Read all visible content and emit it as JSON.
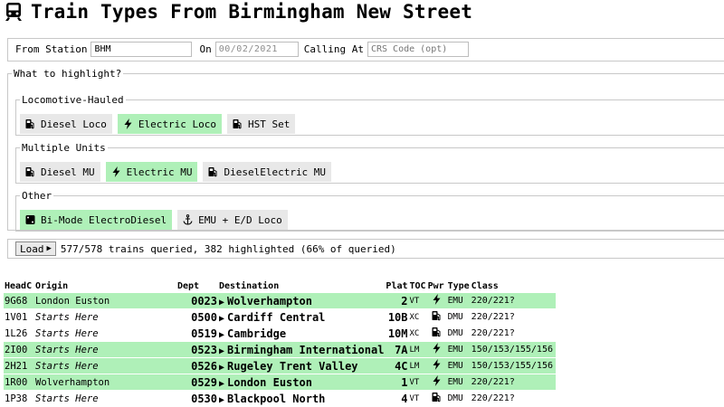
{
  "page": {
    "title": "Train Types From Birmingham New Street",
    "title_icon": "train-icon"
  },
  "query": {
    "from_label": "From Station",
    "from_value": "BHM",
    "on_label": "On",
    "on_value": "00/02/2021",
    "calling_label": "Calling At",
    "calling_placeholder": "CRS Code (opt)"
  },
  "highlight": {
    "legend": "What to highlight?",
    "groups": [
      {
        "legend": "Locomotive-Hauled",
        "buttons": [
          {
            "label": "Diesel Loco",
            "icon": "fuel-pump-icon",
            "on": false
          },
          {
            "label": "Electric Loco",
            "icon": "lightning-bolt-icon",
            "on": true
          },
          {
            "label": "HST Set",
            "icon": "fuel-pump-icon",
            "on": false
          }
        ]
      },
      {
        "legend": "Multiple Units",
        "buttons": [
          {
            "label": "Diesel MU",
            "icon": "fuel-pump-icon",
            "on": false
          },
          {
            "label": "Electric MU",
            "icon": "lightning-bolt-icon",
            "on": true
          },
          {
            "label": "DieselElectric MU",
            "icon": "fuel-pump-icon",
            "on": false
          }
        ]
      },
      {
        "legend": "Other",
        "buttons": [
          {
            "label": "Bi-Mode ElectroDiesel",
            "icon": "dice-icon",
            "on": true
          },
          {
            "label": "EMU + E/D Loco",
            "icon": "anchor-icon",
            "on": false
          }
        ]
      }
    ]
  },
  "load": {
    "button_label": "Load",
    "status": "577/578 trains queried, 382 highlighted (66% of queried)"
  },
  "table": {
    "headers": {
      "headcode": "HeadC",
      "origin": "Origin",
      "dept": "Dept",
      "destination": "Destination",
      "plat": "Plat",
      "toc": "TOC",
      "pwr": "Pwr",
      "type": "Type",
      "class": "Class"
    },
    "rows": [
      {
        "headcode": "9G68",
        "origin": "London Euston",
        "origin_italic": false,
        "dept": "0023",
        "destination": "Wolverhampton",
        "plat": "2",
        "toc": "VT",
        "pwr": "lightning-bolt-icon",
        "type": "EMU",
        "class": "220/221?",
        "highlight": true
      },
      {
        "headcode": "1V01",
        "origin": "Starts Here",
        "origin_italic": true,
        "dept": "0500",
        "destination": "Cardiff Central",
        "plat": "10B",
        "toc": "XC",
        "pwr": "fuel-pump-icon",
        "type": "DMU",
        "class": "220/221?",
        "highlight": false
      },
      {
        "headcode": "1L26",
        "origin": "Starts Here",
        "origin_italic": true,
        "dept": "0519",
        "destination": "Cambridge",
        "plat": "10M",
        "toc": "XC",
        "pwr": "fuel-pump-icon",
        "type": "DMU",
        "class": "220/221?",
        "highlight": false
      },
      {
        "headcode": "2I00",
        "origin": "Starts Here",
        "origin_italic": true,
        "dept": "0523",
        "destination": "Birmingham International",
        "plat": "7A",
        "toc": "LM",
        "pwr": "lightning-bolt-icon",
        "type": "EMU",
        "class": "150/153/155/156",
        "highlight": true
      },
      {
        "headcode": "2H21",
        "origin": "Starts Here",
        "origin_italic": true,
        "dept": "0526",
        "destination": "Rugeley Trent Valley",
        "plat": "4C",
        "toc": "LM",
        "pwr": "lightning-bolt-icon",
        "type": "EMU",
        "class": "150/153/155/156",
        "highlight": true
      },
      {
        "headcode": "1R00",
        "origin": "Wolverhampton",
        "origin_italic": false,
        "dept": "0529",
        "destination": "London Euston",
        "plat": "1",
        "toc": "VT",
        "pwr": "lightning-bolt-icon",
        "type": "EMU",
        "class": "220/221?",
        "highlight": true
      },
      {
        "headcode": "1P38",
        "origin": "Starts Here",
        "origin_italic": true,
        "dept": "0530",
        "destination": "Blackpool North",
        "plat": "4",
        "toc": "VT",
        "pwr": "fuel-pump-icon",
        "type": "DMU",
        "class": "220/221?",
        "highlight": false
      }
    ]
  },
  "colors": {
    "highlight": "#aff0b8",
    "button": "#e8e8e8",
    "border": "#c8c8c8"
  }
}
